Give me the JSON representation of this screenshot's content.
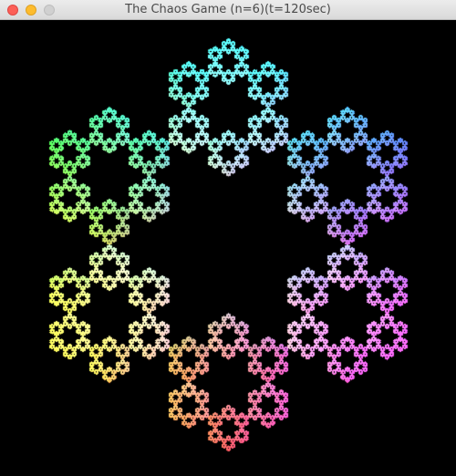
{
  "window": {
    "title": "The Chaos Game (n=6)(t=120sec)",
    "buttons": {
      "close_color": "#fc5f57",
      "minimize_color": "#fdbc2e",
      "zoom_color": "#d0d0d0"
    }
  },
  "canvas": {
    "background": "#000000",
    "fractal": "six-pointed star",
    "colors": {
      "top": "#35c4cf",
      "upper_right": "#3a4fe0",
      "lower_right": "#c23fdc",
      "bottom": "#d8373c",
      "lower_left": "#d2c438",
      "upper_left": "#33c73a",
      "center": "#e8e8e8"
    }
  }
}
